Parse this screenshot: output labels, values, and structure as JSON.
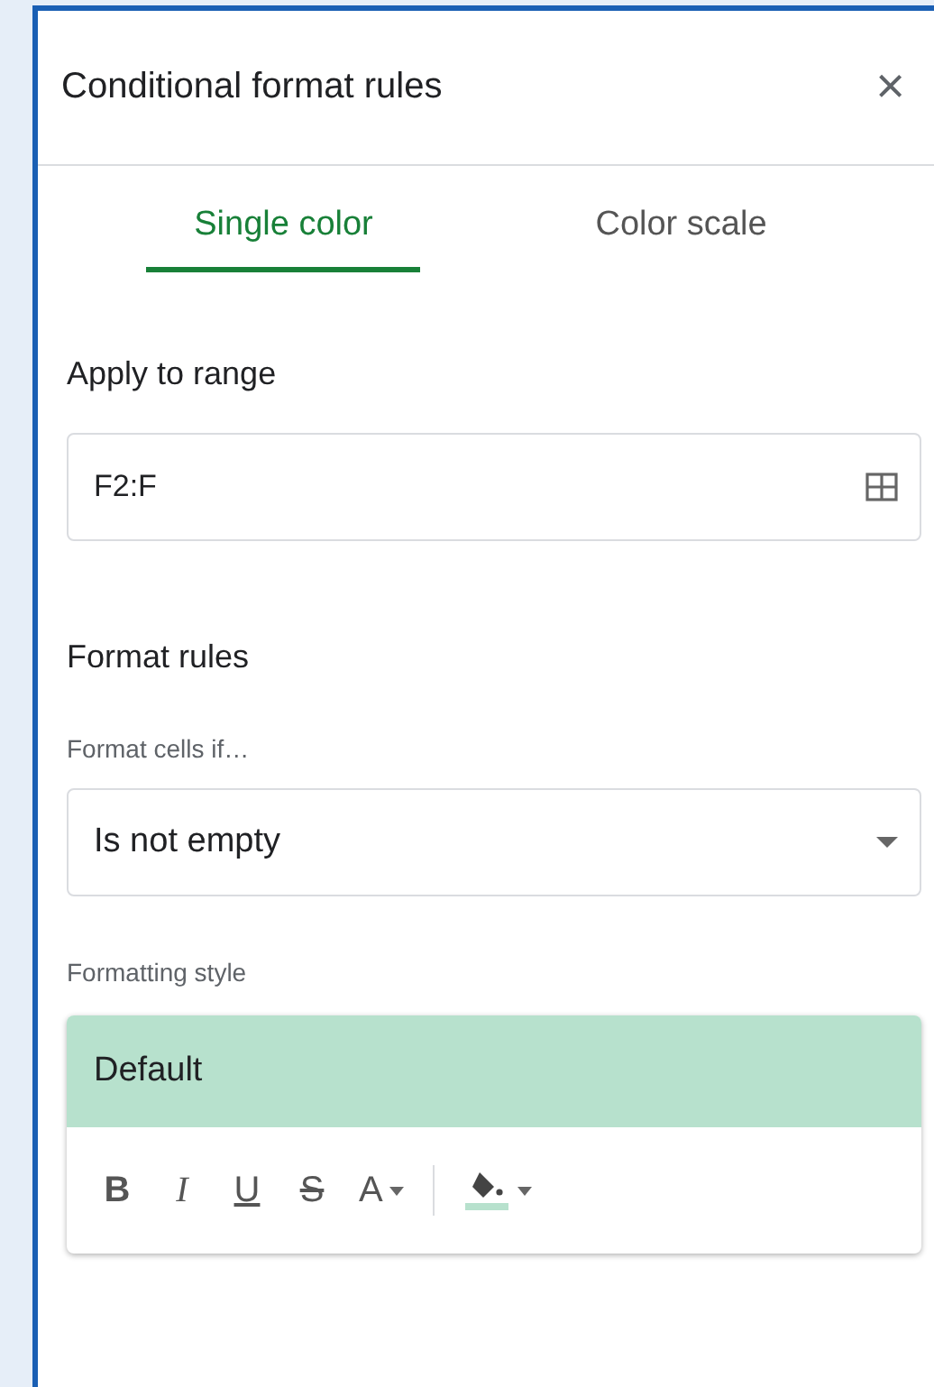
{
  "panel": {
    "title": "Conditional format rules",
    "close": "×"
  },
  "tabs": [
    {
      "label": "Single color",
      "selected": true
    },
    {
      "label": "Color scale",
      "selected": false
    }
  ],
  "apply_to_range": {
    "label": "Apply to range",
    "value": "F2:F"
  },
  "format_rules": {
    "heading": "Format rules",
    "condition_label": "Format cells if…",
    "condition": "Is not empty"
  },
  "formatting_style": {
    "label": "Formatting style",
    "preview": "Default",
    "toolbar": [
      {
        "kind": "bold",
        "label": "B"
      },
      {
        "kind": "italic",
        "label": "I"
      },
      {
        "kind": "underline",
        "label": "U"
      },
      {
        "kind": "strike",
        "label": "S"
      },
      {
        "kind": "text-color",
        "label": "A"
      },
      {
        "kind": "fill-color"
      }
    ]
  }
}
